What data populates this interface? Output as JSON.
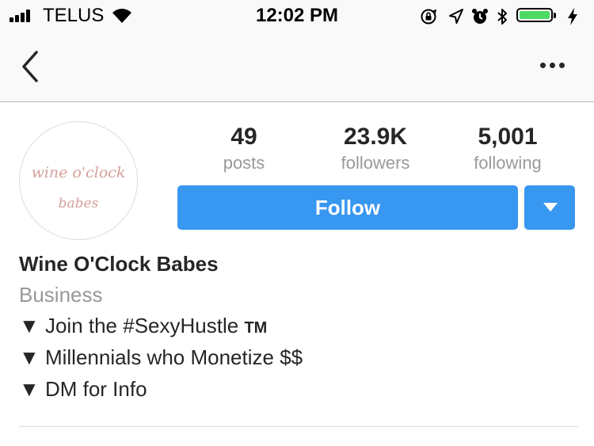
{
  "status_bar": {
    "carrier": "TELUS",
    "time": "12:02 PM",
    "battery_level": 1.0,
    "battery_color": "#4cd964",
    "icons": [
      "signal-icon",
      "wifi-icon",
      "orientation-lock-icon",
      "location-icon",
      "alarm-icon",
      "bluetooth-icon",
      "battery-icon",
      "charging-icon"
    ]
  },
  "nav": {
    "back_icon": "chevron-left-icon",
    "more_icon": "ellipsis-icon"
  },
  "profile": {
    "avatar_line1": "wine o'clock",
    "avatar_line2": "babes",
    "stats": [
      {
        "count": "49",
        "label": "posts"
      },
      {
        "count": "23.9K",
        "label": "followers"
      },
      {
        "count": "5,001",
        "label": "following"
      }
    ],
    "follow_label": "Follow",
    "accent_color": "#3897f0",
    "name": "Wine O'Clock Babes",
    "category": "Business",
    "bio": [
      {
        "text": "▼ Join the #SexyHustle ",
        "suffix": "TM"
      },
      {
        "text": "▼ Millennials who Monetize $$"
      },
      {
        "text": "▼ DM for Info"
      }
    ]
  }
}
